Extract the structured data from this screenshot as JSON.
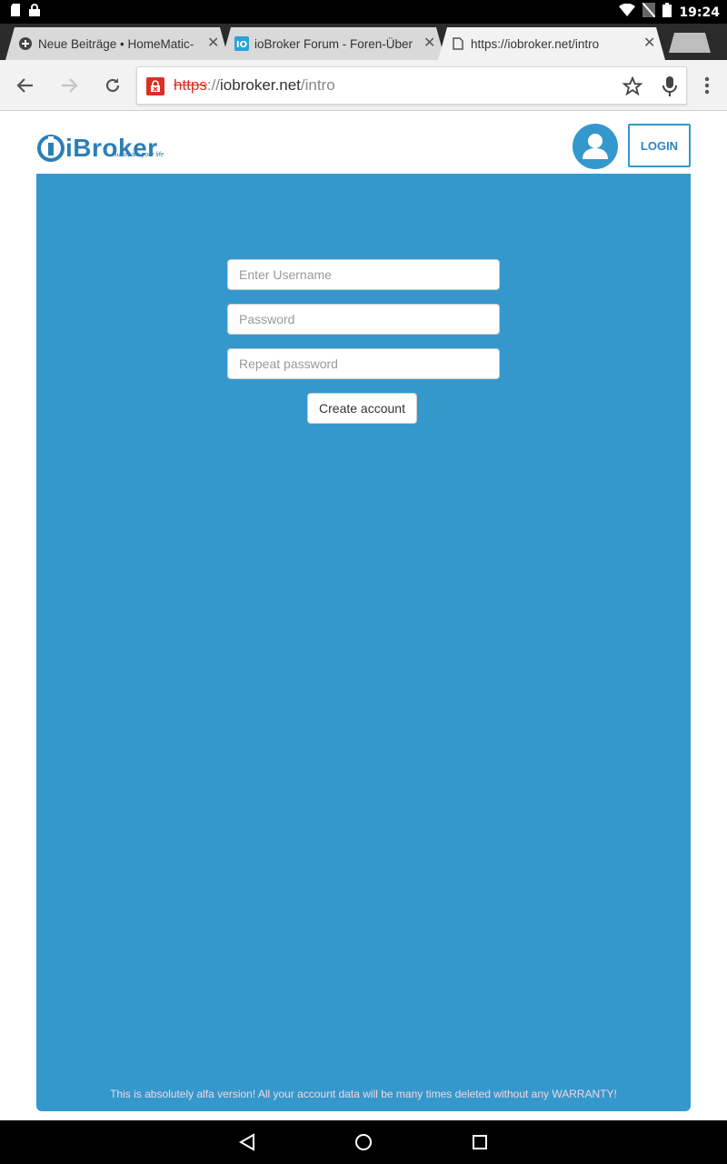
{
  "status_bar": {
    "time": "19:24",
    "icons": [
      "sd-card-icon",
      "lock-icon",
      "wifi-icon",
      "no-sim-icon",
      "battery-icon"
    ]
  },
  "tabs": [
    {
      "title": "Neue Beiträge • HomeMatic-",
      "favicon": "plus-circle-icon",
      "active": false
    },
    {
      "title": "ioBroker Forum - Foren-Über",
      "favicon": "iobroker-favicon",
      "active": false
    },
    {
      "title": "https://iobroker.net/intro",
      "favicon": "document-icon",
      "active": true
    }
  ],
  "omnibox": {
    "scheme": "https",
    "separator": "://",
    "host": "iobroker.net",
    "path": "/intro"
  },
  "header": {
    "logo_text": "iBroker",
    "logo_tagline": "Automate your life",
    "login_label": "LOGIN"
  },
  "form": {
    "username_placeholder": "Enter Username",
    "password_placeholder": "Password",
    "repeat_password_placeholder": "Repeat password",
    "create_label": "Create account"
  },
  "disclaimer": "This is absolutely alfa version! All your account data will be many times deleted without any WARRANTY!",
  "colors": {
    "panel": "#3498cc",
    "accent": "#2e86c1",
    "insecure": "#d93025"
  }
}
